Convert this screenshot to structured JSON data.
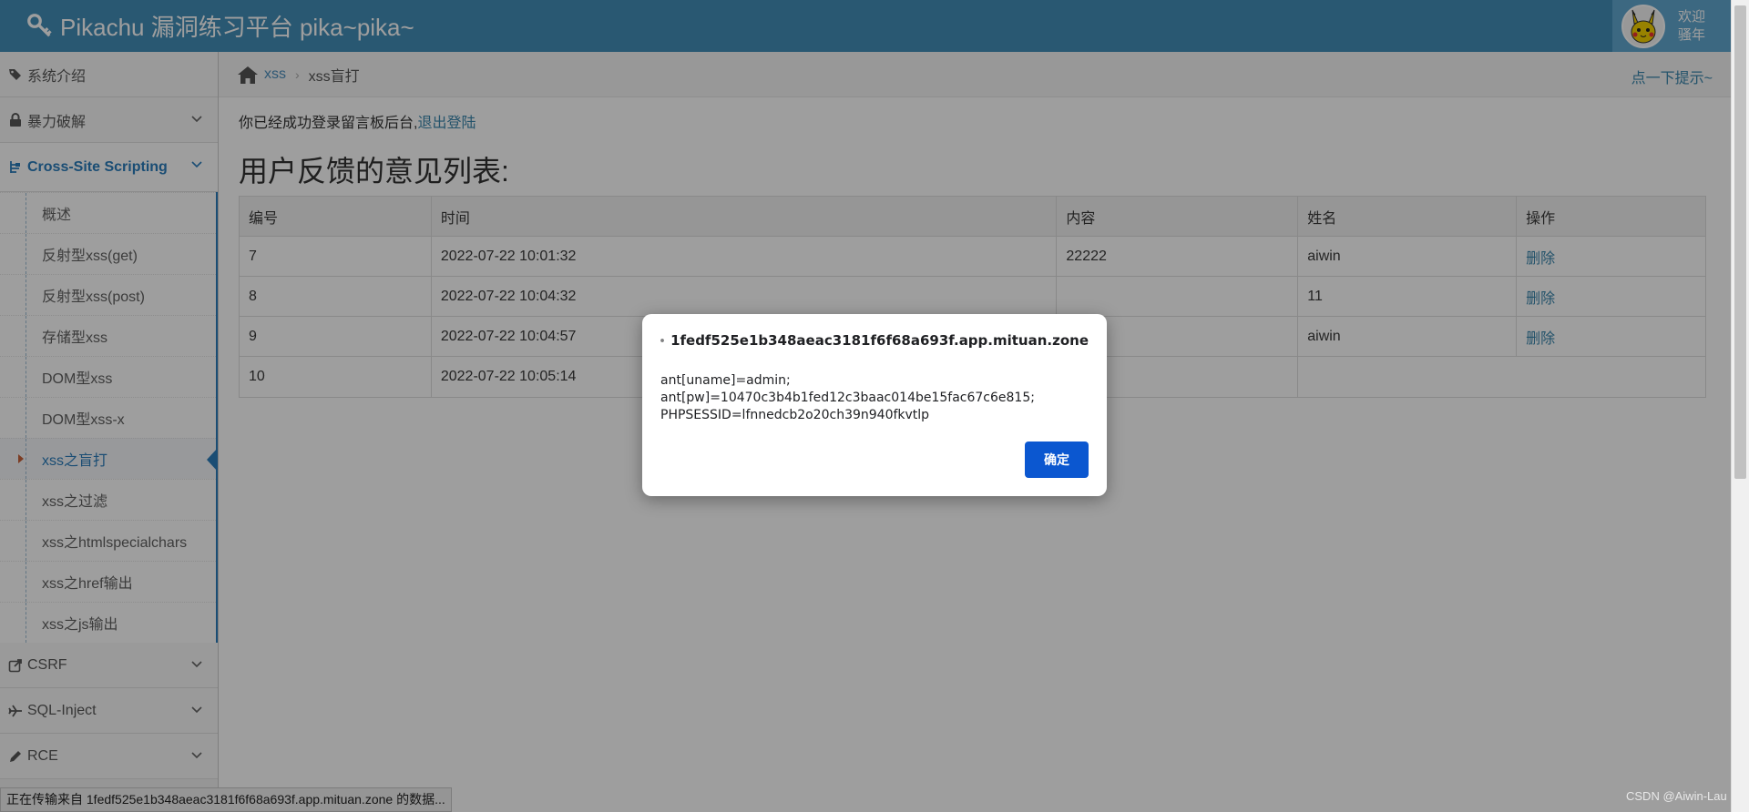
{
  "header": {
    "brand": "Pikachu 漏洞练习平台 pika~pika~",
    "welcome_line1": "欢迎",
    "welcome_line2": "骚年"
  },
  "sidebar": {
    "items": [
      {
        "label": "系统介绍",
        "icon": "tags-icon"
      },
      {
        "label": "暴力破解",
        "icon": "lock-icon"
      },
      {
        "label": "Cross-Site Scripting",
        "icon": "sitemap-icon"
      }
    ],
    "xss_submenu": [
      "概述",
      "反射型xss(get)",
      "反射型xss(post)",
      "存储型xss",
      "DOM型xss",
      "DOM型xss-x",
      "xss之盲打",
      "xss之过滤",
      "xss之htmlspecialchars",
      "xss之href输出",
      "xss之js输出"
    ],
    "current_sub": "xss之盲打",
    "bottom_items": [
      {
        "label": "CSRF",
        "icon": "share-icon"
      },
      {
        "label": "SQL-Inject",
        "icon": "plane-icon"
      },
      {
        "label": "RCE",
        "icon": "pencil-icon"
      }
    ]
  },
  "breadcrumb": {
    "parent": "xss",
    "current": "xss盲打",
    "hint": "点一下提示~"
  },
  "main": {
    "logged_text": "你已经成功登录留言板后台,",
    "logout_link": "退出登陆",
    "title": "用户反馈的意见列表:",
    "columns": [
      "编号",
      "时间",
      "内容",
      "姓名",
      "操作"
    ],
    "rows": [
      {
        "id": "7",
        "time": "2022-07-22 10:01:32",
        "content": "22222",
        "name": "aiwin",
        "action": "删除"
      },
      {
        "id": "8",
        "time": "2022-07-22 10:04:32",
        "content": "",
        "name": "11",
        "action": "删除"
      },
      {
        "id": "9",
        "time": "2022-07-22 10:04:57",
        "content": "",
        "name": "aiwin",
        "action": "删除"
      },
      {
        "id": "10",
        "time": "2022-07-22 10:05:14",
        "content": "",
        "name": "",
        "action": ""
      }
    ]
  },
  "dialog": {
    "origin": "1fedf525e1b348aeac3181f6f68a693f.app.mituan.zone",
    "message": "ant[uname]=admin;\nant[pw]=10470c3b4b1fed12c3baac014be15fac67c6e815;\nPHPSESSID=lfnnedcb2o20ch39n940fkvtlp",
    "ok_label": "确定"
  },
  "status": {
    "text": "正在传输来自 1fedf525e1b348aeac3181f6f68a693f.app.mituan.zone 的数据...",
    "watermark": "CSDN @Aiwin-Lau"
  },
  "colors": {
    "navbar": "#438eb9",
    "accent": "#2b7dbc",
    "dialog_button": "#0b57d0"
  }
}
